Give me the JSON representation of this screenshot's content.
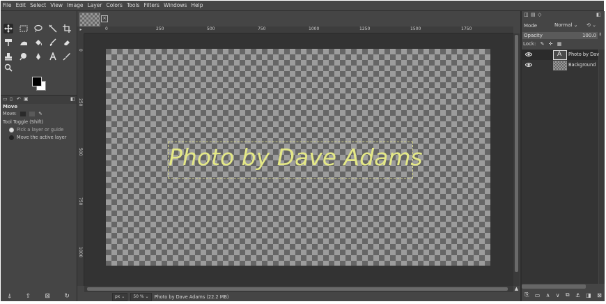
{
  "menu": [
    "File",
    "Edit",
    "Select",
    "View",
    "Image",
    "Layer",
    "Colors",
    "Tools",
    "Filters",
    "Windows",
    "Help"
  ],
  "tool_options": {
    "title": "Move",
    "move_label": "Move:",
    "toggle_label": "Tool Toggle  (Shift)",
    "option1": "Pick a layer or guide",
    "option2": "Move the active layer"
  },
  "ruler": {
    "labels": [
      "0",
      "250",
      "500",
      "750",
      "1000",
      "1250",
      "1500",
      "1750"
    ]
  },
  "vruler": {
    "labels": [
      "0",
      "250",
      "500",
      "750",
      "1000"
    ]
  },
  "canvas": {
    "text": "Photo by Dave Adams"
  },
  "status": {
    "unit": "px",
    "zoom": "50 %",
    "text": "Photo by Dave Adams (22.2 MB)"
  },
  "layers_panel": {
    "mode_label": "Mode",
    "mode_value": "Normal",
    "opacity_label": "Opacity",
    "opacity_value": "100.0",
    "lock_label": "Lock:",
    "layers": [
      {
        "name": "Photo by Dave",
        "type": "text"
      },
      {
        "name": "Background",
        "type": "image"
      }
    ]
  },
  "colors": {
    "foreground": "#000000",
    "background": "#ffffff",
    "text_layer": "#e4e886"
  }
}
